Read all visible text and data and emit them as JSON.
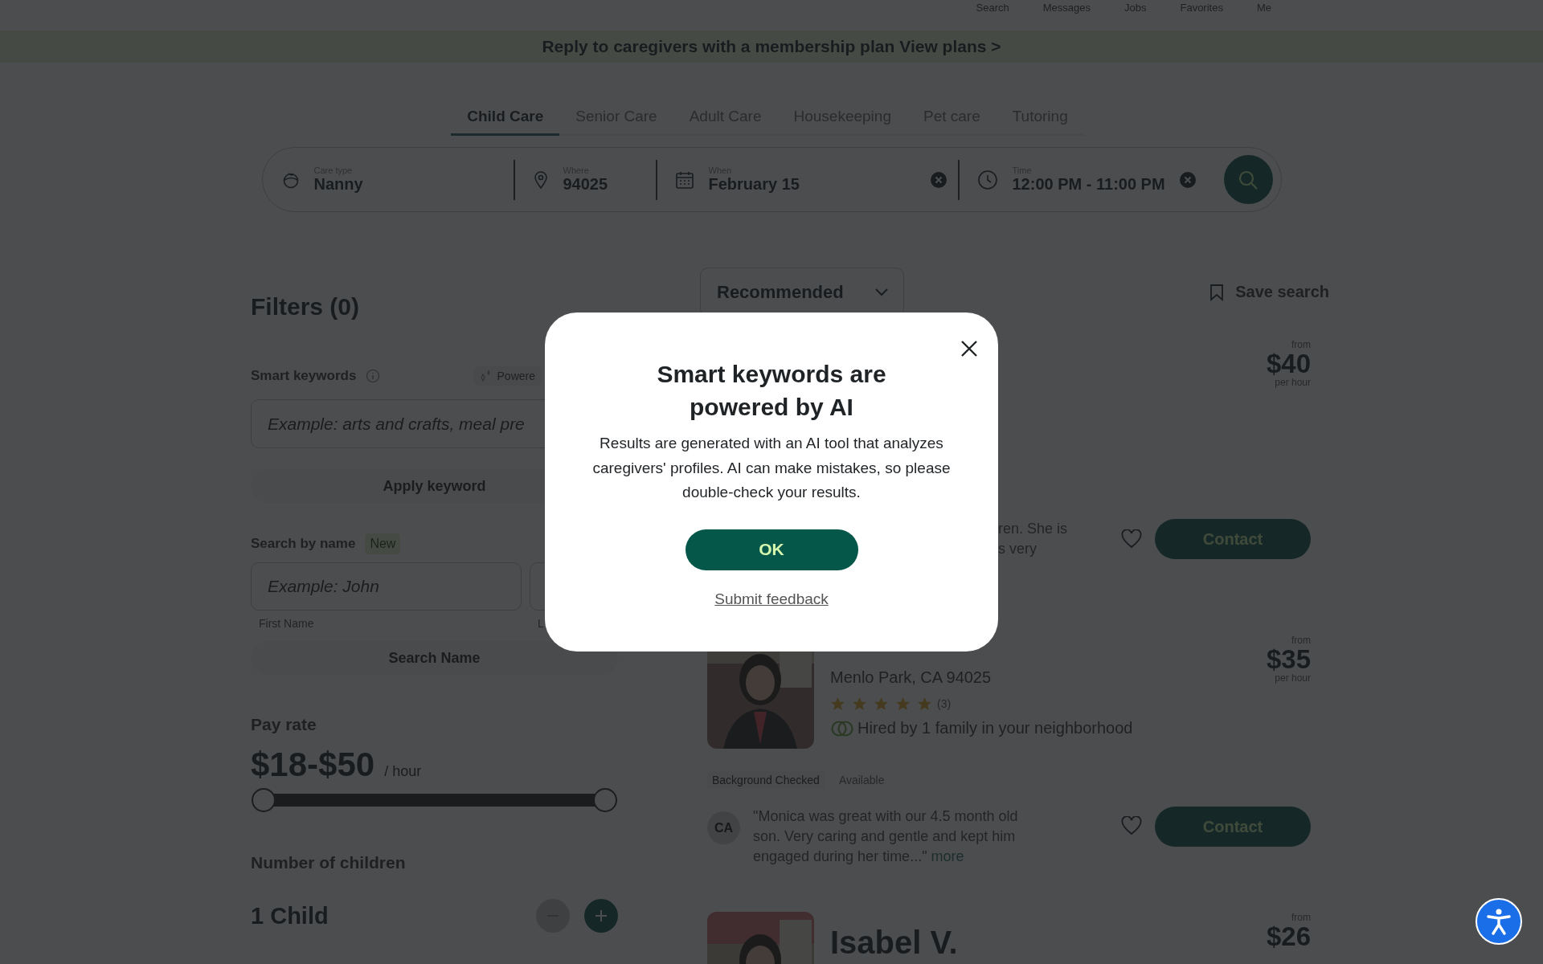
{
  "top_nav": [
    "Search",
    "Messages",
    "Jobs",
    "Favorites",
    "Me"
  ],
  "banner": {
    "text": "Reply to caregivers with a membership plan",
    "link": "View plans >"
  },
  "tabs": [
    {
      "label": "Child Care",
      "selected": true
    },
    {
      "label": "Senior Care",
      "selected": false
    },
    {
      "label": "Adult Care",
      "selected": false
    },
    {
      "label": "Housekeeping",
      "selected": false
    },
    {
      "label": "Pet care",
      "selected": false
    },
    {
      "label": "Tutoring",
      "selected": false
    }
  ],
  "search_bar": {
    "fields": [
      {
        "kind": "care",
        "label": "Care type",
        "value": "Nanny",
        "clearable": false
      },
      {
        "kind": "where",
        "label": "Where",
        "value": "94025",
        "clearable": false
      },
      {
        "kind": "when",
        "label": "When",
        "value": "February 15",
        "clearable": true
      },
      {
        "kind": "time",
        "label": "Time",
        "value": "12:00 PM - 11:00 PM",
        "clearable": true
      }
    ]
  },
  "filters": {
    "title": "Filters (0)",
    "smart_keywords": {
      "label": "Smart keywords",
      "badge": "Powere",
      "placeholder": "Example: arts and crafts, meal pre",
      "button": "Apply keyword"
    },
    "search_by_name": {
      "label": "Search by name",
      "badge": "New",
      "first_placeholder": "Example: John",
      "first_label": "First Name",
      "last_label": "L",
      "button": "Search Name"
    },
    "pay_rate": {
      "label": "Pay rate",
      "value": "$18-$50",
      "unit": "/ hour",
      "thumbs": [
        {
          "level": 0
        },
        {
          "level": 1
        }
      ]
    },
    "children": {
      "label": "Number of children",
      "value": "1 Child",
      "minus_disabled": true,
      "plus_disabled": false
    }
  },
  "results": {
    "sort": "Recommended",
    "save_search": "Save search",
    "cards": [
      {
        "price_from": "from",
        "price": "$40",
        "price_unit": "per hour",
        "review_fragment": [
          "ren. She is",
          "s very"
        ],
        "contact": "Contact"
      },
      {
        "photo": {
          "kind": "picture"
        },
        "location": "Menlo Park, CA 94025",
        "stars": 5,
        "review_count": "(3)",
        "hired": "Hired by 1 family in your neighborhood",
        "tags": [
          {
            "label": "Background Checked",
            "kind": "check"
          },
          {
            "label": "Available",
            "kind": "status"
          }
        ],
        "review": {
          "avatar": "CA",
          "text": "\"Monica was great with our 4.5 month old son. Very caring and gentle and kept him engaged during her time...\"",
          "more": "more"
        },
        "price_from": "from",
        "price": "$35",
        "price_unit": "per hour",
        "contact": "Contact"
      },
      {
        "photo": {
          "kind": "picture"
        },
        "name": "Isabel V.",
        "price_from": "from",
        "price": "$26"
      }
    ]
  },
  "modal": {
    "title": "Smart keywords are powered by AI",
    "body": "Results are generated with an AI tool that analyzes caregivers' profiles. AI can make mistakes, so please double-check your results.",
    "ok": "OK",
    "feedback": "Submit feedback"
  }
}
